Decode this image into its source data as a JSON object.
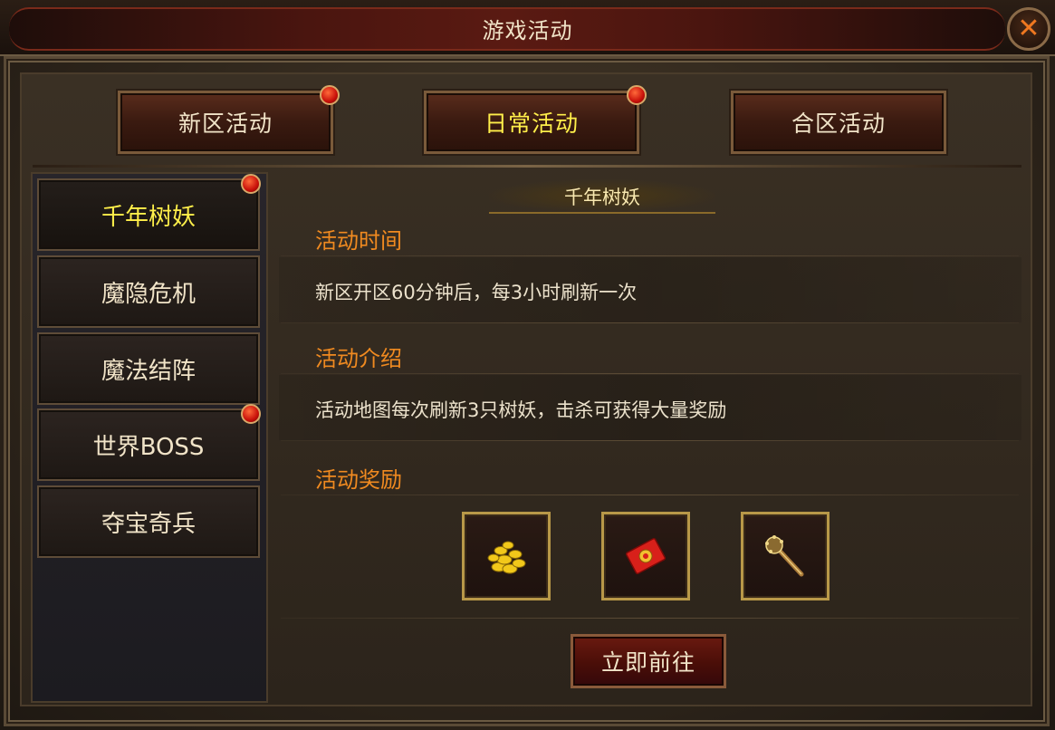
{
  "window": {
    "title": "游戏活动",
    "close_symbol": "✕"
  },
  "tabs": [
    {
      "label": "新区活动",
      "has_notice": true
    },
    {
      "label": "日常活动",
      "has_notice": true,
      "active": true
    },
    {
      "label": "合区活动",
      "has_notice": false
    }
  ],
  "sidebar": {
    "items": [
      {
        "label": "千年树妖",
        "active": true,
        "has_notice": true
      },
      {
        "label": "魔隐危机",
        "has_notice": false
      },
      {
        "label": "魔法结阵",
        "has_notice": false
      },
      {
        "label": "世界BOSS",
        "has_notice": true
      },
      {
        "label": "夺宝奇兵",
        "has_notice": false
      }
    ]
  },
  "detail": {
    "title": "千年树妖",
    "time_heading": "活动时间",
    "time_text": "新区开区60分钟后，每3小时刷新一次",
    "intro_heading": "活动介绍",
    "intro_text": "活动地图每次刷新3只树妖，击杀可获得大量奖励",
    "reward_heading": "活动奖励",
    "rewards": [
      {
        "icon": "gold-coins-icon"
      },
      {
        "icon": "red-envelope-icon"
      },
      {
        "icon": "mace-weapon-icon"
      }
    ],
    "go_button": "立即前往"
  },
  "colors": {
    "heading_orange": "#f08a20",
    "active_yellow": "#ffef4a",
    "text_light": "#f1e4c8"
  }
}
